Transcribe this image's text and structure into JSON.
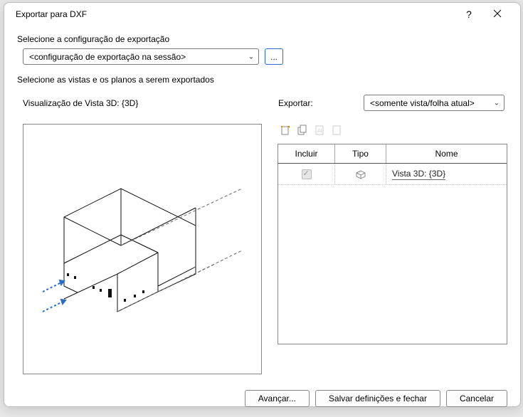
{
  "titlebar": {
    "title": "Exportar para DXF"
  },
  "config": {
    "label": "Selecione a configuração de exportação",
    "selected": "<configuração de exportação na sessão>",
    "dots": "..."
  },
  "views": {
    "label": "Selecione as vistas e os planos a serem exportados",
    "preview_title": "Visualização de Vista 3D: {3D}",
    "export_label": "Exportar:",
    "export_selected": "<somente vista/folha atual>"
  },
  "table": {
    "headers": {
      "include": "Incluir",
      "type": "Tipo",
      "name": "Nome"
    },
    "rows": [
      {
        "name": "Vista 3D: {3D}"
      }
    ]
  },
  "footer": {
    "next": "Avançar...",
    "save": "Salvar definições e fechar",
    "cancel": "Cancelar"
  }
}
